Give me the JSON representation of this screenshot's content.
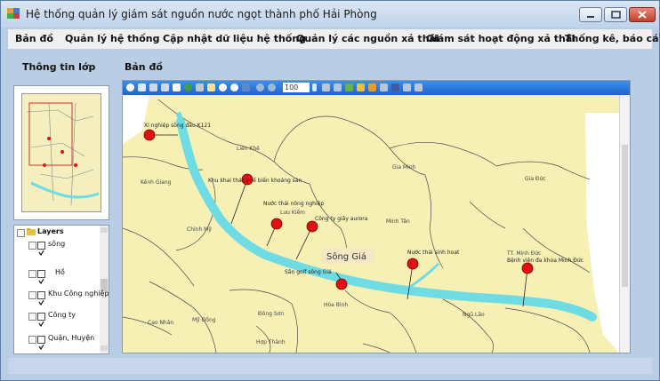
{
  "window": {
    "title": "Hệ thống quản lý giám sát nguồn nước ngọt thành phố Hải Phòng"
  },
  "menu": [
    "Bản đồ",
    "Quản lý hệ thống",
    "Cập nhật dữ liệu hệ thống",
    "Quản lý các nguồn xả thải",
    "Giám sát hoạt động xả thải",
    "Thống kê, báo cáo"
  ],
  "panels": {
    "layer_info_title": "Thông tin lớp",
    "map_title": "Bản đồ"
  },
  "toolbar": {
    "zoom_value": "100"
  },
  "layers": {
    "root": "Layers",
    "items": [
      "sông",
      "Hồ",
      "Khu Công nghiệp",
      "Công ty",
      "Quận, Huyện"
    ]
  },
  "map": {
    "river_label": "Sông Giá",
    "places": [
      "Liên Khê",
      "Kênh Giang",
      "Lưu Kiếm",
      "Gia Minh",
      "Gia Đức",
      "Minh Tân",
      "Chính Mỹ",
      "Mỹ Đồng",
      "Cao Nhân",
      "Đông Sơn",
      "Hòa Bình",
      "Ngũ Lão",
      "TT. Minh Đức",
      "Hợp Thành"
    ],
    "facilities": [
      "Xí nghiệp sông đầu K121",
      "Khu khai thác chế biến khoáng sản",
      "Nước thải nông nghiệp",
      "Công ty giấy aurora",
      "Sân golf sông Giá",
      "Nước thải sinh hoạt",
      "Bệnh viện đa khoa Minh Đức"
    ],
    "colors": {
      "land": "#f7f0b5",
      "river": "#6fdbe3",
      "boundary": "#4a4a4a",
      "marker": "#e01010"
    }
  }
}
